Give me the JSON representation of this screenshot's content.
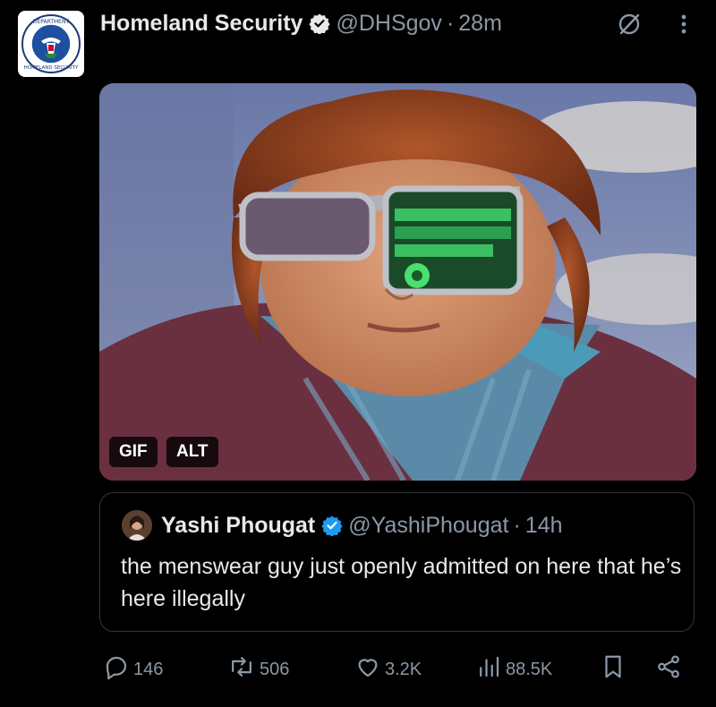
{
  "tweet": {
    "author_name": "Homeland Security",
    "handle": "@DHSgov",
    "separator": "·",
    "time": "28m",
    "seal_text": "U.S. DEPARTMENT OF HOMELAND SECURITY"
  },
  "media": {
    "gif_label": "GIF",
    "alt_label": "ALT"
  },
  "quote": {
    "author_name": "Yashi Phougat",
    "handle": "@YashiPhougat",
    "separator": "·",
    "time": "14h",
    "text": "the menswear guy just openly admitted on here that he’s here illegally"
  },
  "actions": {
    "replies": "146",
    "reposts": "506",
    "likes": "3.2K",
    "views": "88.5K"
  },
  "colors": {
    "background": "#000000",
    "text": "#e7e9ea",
    "secondary": "#8b98a5",
    "verified": "#1d9bf0",
    "border": "#333639"
  }
}
